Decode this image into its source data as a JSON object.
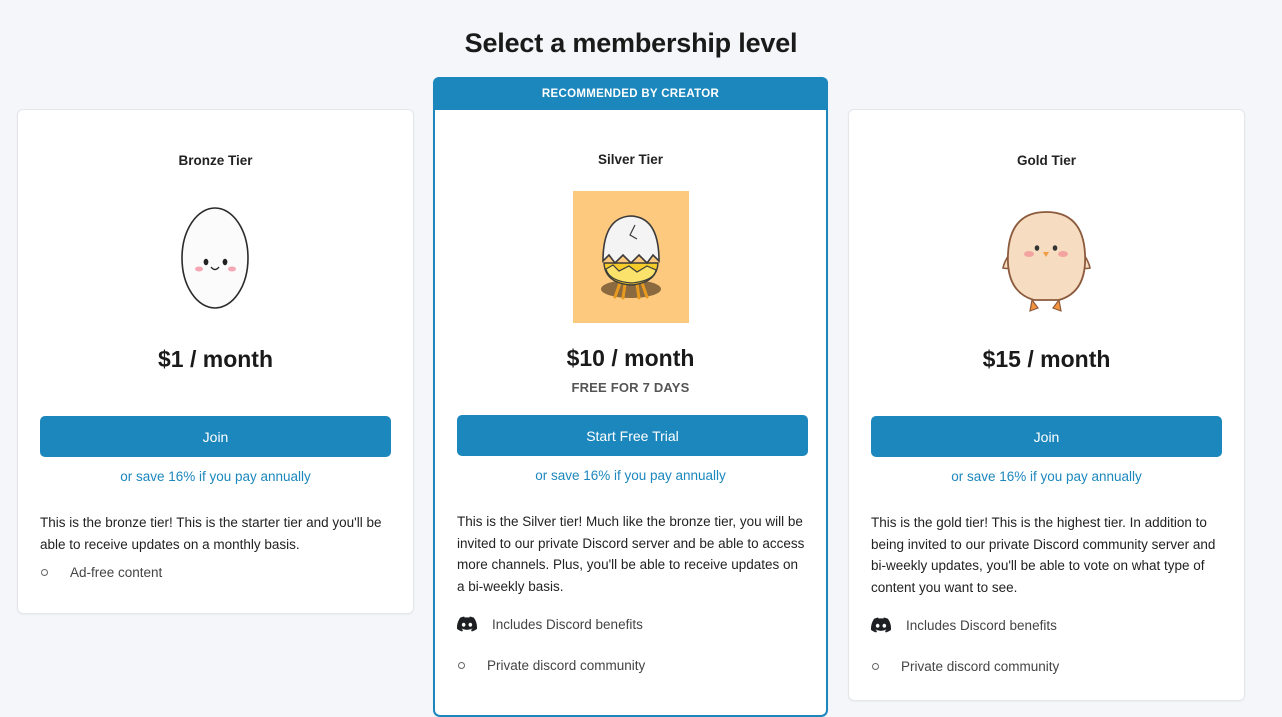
{
  "page": {
    "title": "Select a membership level"
  },
  "colors": {
    "accent": "#1c87bd",
    "background": "#f4f6fa"
  },
  "tiers": [
    {
      "name": "Bronze Tier",
      "image": "egg-mascot",
      "price": "$1 / month",
      "button": "Join",
      "save_link": "or save 16% if you pay annually",
      "description": "This is the bronze tier! This is the starter tier and you'll be able to receive updates on a monthly basis.",
      "benefits": [
        "Ad-free content"
      ]
    },
    {
      "name": "Silver Tier",
      "badge": "RECOMMENDED BY CREATOR",
      "image": "hatching-chick",
      "price": "$10 / month",
      "trial": "FREE FOR 7 DAYS",
      "button": "Start Free Trial",
      "save_link": "or save 16% if you pay annually",
      "description": "This is the Silver tier! Much like the bronze tier, you will be invited to our private Discord server and be able to access more channels. Plus, you'll be able to receive updates on a bi-weekly basis.",
      "discord_benefit": "Includes Discord benefits",
      "benefits": [
        "Private discord community"
      ]
    },
    {
      "name": "Gold Tier",
      "image": "chick-mascot",
      "price": "$15 / month",
      "button": "Join",
      "save_link": "or save 16% if you pay annually",
      "description": "This is the gold tier! This is the highest tier. In addition to being invited to our private Discord community server and bi-weekly updates, you'll be able to vote on what type of content you want to see.",
      "discord_benefit": "Includes Discord benefits",
      "benefits": [
        "Private discord community"
      ]
    }
  ]
}
